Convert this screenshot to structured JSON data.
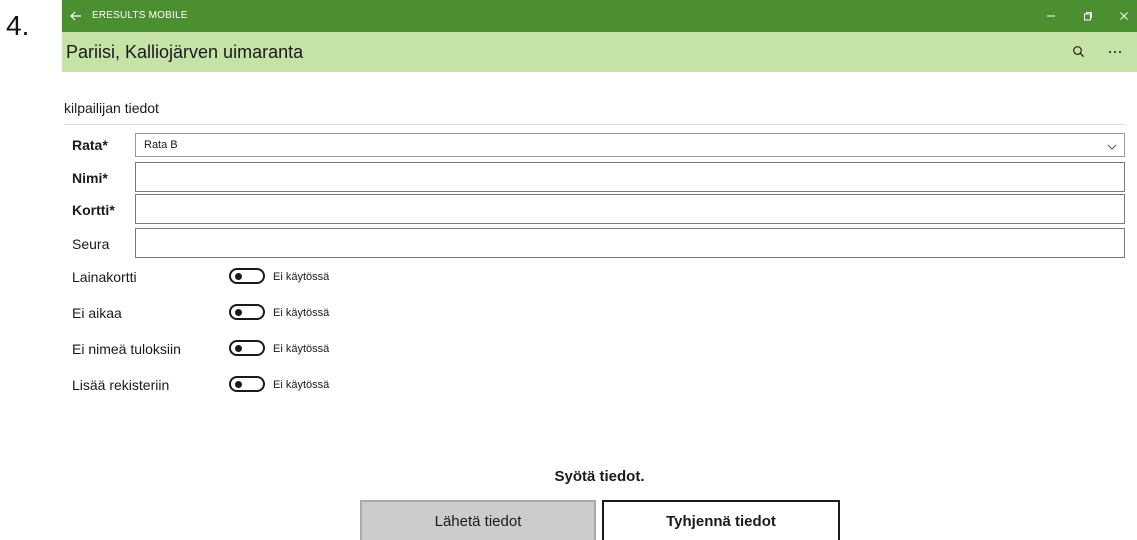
{
  "step_number": "4.",
  "titlebar": {
    "title": "ERESULTS MOBILE",
    "back_icon": "arrow-left-icon",
    "minimize_icon": "minimize-icon",
    "restore_icon": "restore-icon",
    "close_icon": "close-icon"
  },
  "header": {
    "title": "Pariisi, Kalliojärven uimaranta",
    "search_icon": "search-icon",
    "more_icon": "more-icon"
  },
  "form": {
    "section_title": "kilpailijan tiedot",
    "rata": {
      "label": "Rata*",
      "selected": "Rata B"
    },
    "nimi": {
      "label": "Nimi*",
      "value": ""
    },
    "kortti": {
      "label": "Kortti*",
      "value": ""
    },
    "seura": {
      "label": "Seura",
      "value": ""
    },
    "toggles": [
      {
        "label": "Lainakortti",
        "state": "Ei käytössä"
      },
      {
        "label": "Ei aikaa",
        "state": "Ei käytössä"
      },
      {
        "label": "Ei nimeä tuloksiin",
        "state": "Ei käytössä"
      },
      {
        "label": "Lisää rekisteriin",
        "state": "Ei käytössä"
      }
    ]
  },
  "message": "Syötä tiedot.",
  "buttons": {
    "send": "Lähetä tiedot",
    "clear": "Tyhjennä tiedot"
  },
  "colors": {
    "titlebar": "#4c8f30",
    "header": "#c5e3a7"
  }
}
